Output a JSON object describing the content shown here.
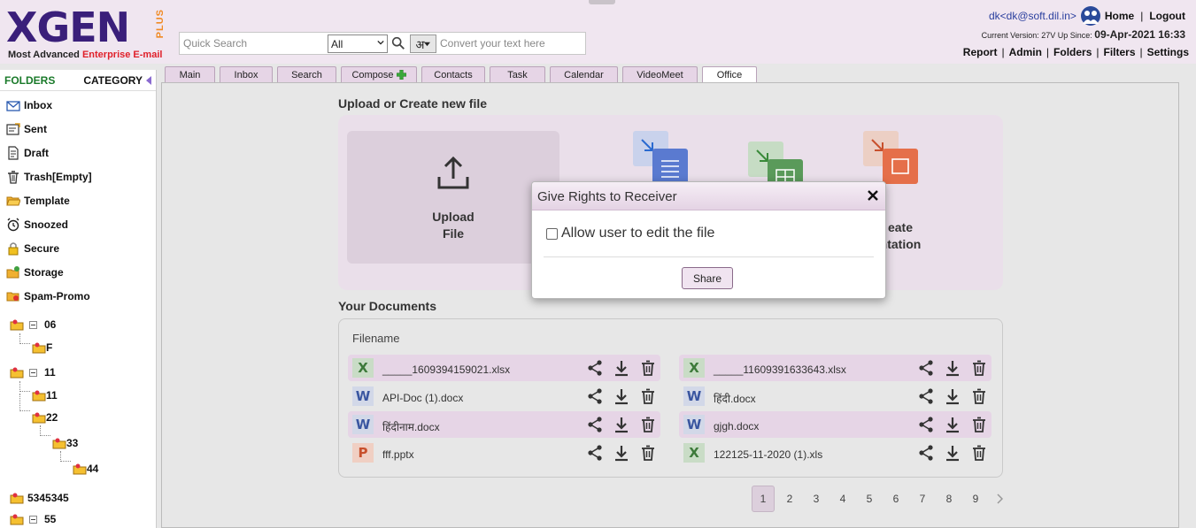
{
  "brand": {
    "logo_text": "XGEN",
    "logo_plus": "PLUS",
    "tagline_prefix": "Most Advanced ",
    "tagline_accent": "Enterprise E-mail"
  },
  "search": {
    "placeholder": "Quick Search",
    "filter_value": "All",
    "lang_label": "अ",
    "convert_placeholder": "Convert your text here"
  },
  "user": {
    "email": "dk<dk@soft.dil.in>",
    "home_label": "Home",
    "logout_label": "Logout",
    "version_text": "Current Version: 27V Up Since:",
    "version_date": "09-Apr-2021 16:33"
  },
  "topnav": [
    "Report",
    "Admin",
    "Folders",
    "Filters",
    "Settings"
  ],
  "sidebar": {
    "folders_label": "FOLDERS",
    "category_label": "CATEGORY",
    "items": [
      "Inbox",
      "Sent",
      "Draft",
      "Trash[Empty]",
      "Template",
      "Snoozed",
      "Secure",
      "Storage",
      "Spam-Promo"
    ],
    "tree": [
      "06",
      "F",
      "11",
      "11",
      "22",
      "33",
      "44",
      "5345345",
      "55"
    ]
  },
  "tabs": [
    "Main",
    "Inbox",
    "Search",
    "Compose",
    "Contacts",
    "Task",
    "Calendar",
    "VideoMeet",
    "Office"
  ],
  "upload": {
    "title": "Upload or Create new file",
    "upload_label_1": "Upload",
    "upload_label_2": "File",
    "presentation_label_1": "eate",
    "presentation_label_2": "ntation"
  },
  "documents": {
    "title": "Your Documents",
    "column_header": "Filename",
    "left": [
      {
        "type": "X",
        "name": "_____1609394159021.xlsx"
      },
      {
        "type": "W",
        "name": "API-Doc (1).docx"
      },
      {
        "type": "W",
        "name": "हिंदीनाम.docx"
      },
      {
        "type": "P",
        "name": "fff.pptx"
      }
    ],
    "right": [
      {
        "type": "X",
        "name": "_____11609391633643.xlsx"
      },
      {
        "type": "W",
        "name": "हिंदी.docx"
      },
      {
        "type": "W",
        "name": "gjgh.docx"
      },
      {
        "type": "X",
        "name": "122125-11-2020 (1).xls"
      }
    ]
  },
  "pagination": [
    "1",
    "2",
    "3",
    "4",
    "5",
    "6",
    "7",
    "8",
    "9"
  ],
  "modal": {
    "title": "Give Rights to Receiver",
    "checkbox_label": "Allow user to edit the file",
    "share_label": "Share"
  },
  "colors": {
    "header_bg": "#f0e6f0",
    "accent_purple": "#3a1f7a",
    "accent_orange": "#f08a24",
    "tab_bg": "#e6d5e6"
  }
}
